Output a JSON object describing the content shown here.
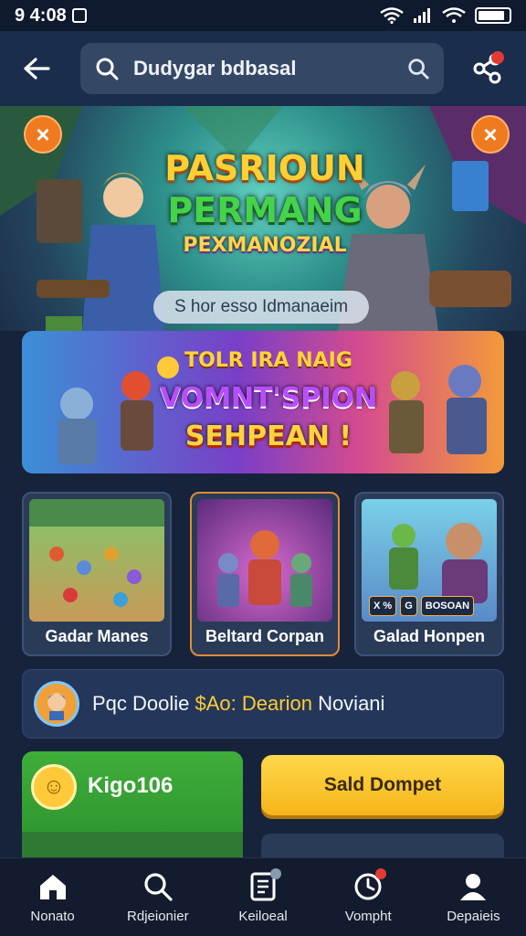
{
  "status": {
    "time": "9 4:08"
  },
  "header": {
    "search_value": "Dudygar bdbasal"
  },
  "hero": {
    "title_line1": "PASRIOUN",
    "title_line2": "PERMANG",
    "title_line3": "PEXMANOZIAL",
    "subtitle": "S hor esso Idmanaeim"
  },
  "promo": {
    "line1": "TOLR IRA NAIG",
    "line2": "VOMNT'SPION",
    "line3": "SEHPEAN !"
  },
  "games": [
    {
      "name": "Gadar Manes"
    },
    {
      "name": "Beltard Corpan"
    },
    {
      "name": "Galad Honpen",
      "badge1": "X %",
      "badge2": "G",
      "badge3": "BOSOAN"
    }
  ],
  "info": {
    "text_a": "Pqc Doolie",
    "text_highlight": "$Ao: Dearion",
    "text_b": "Noviani"
  },
  "reward": {
    "label": "Kigo106"
  },
  "actions": {
    "primary_label": "Sald Dompet"
  },
  "nav": [
    {
      "label": "Nonato",
      "icon": "home-icon"
    },
    {
      "label": "Rdjeionier",
      "icon": "search-icon"
    },
    {
      "label": "Keiloeal",
      "icon": "document-icon"
    },
    {
      "label": "Vompht",
      "icon": "clock-icon"
    },
    {
      "label": "Depaieis",
      "icon": "profile-icon"
    }
  ]
}
